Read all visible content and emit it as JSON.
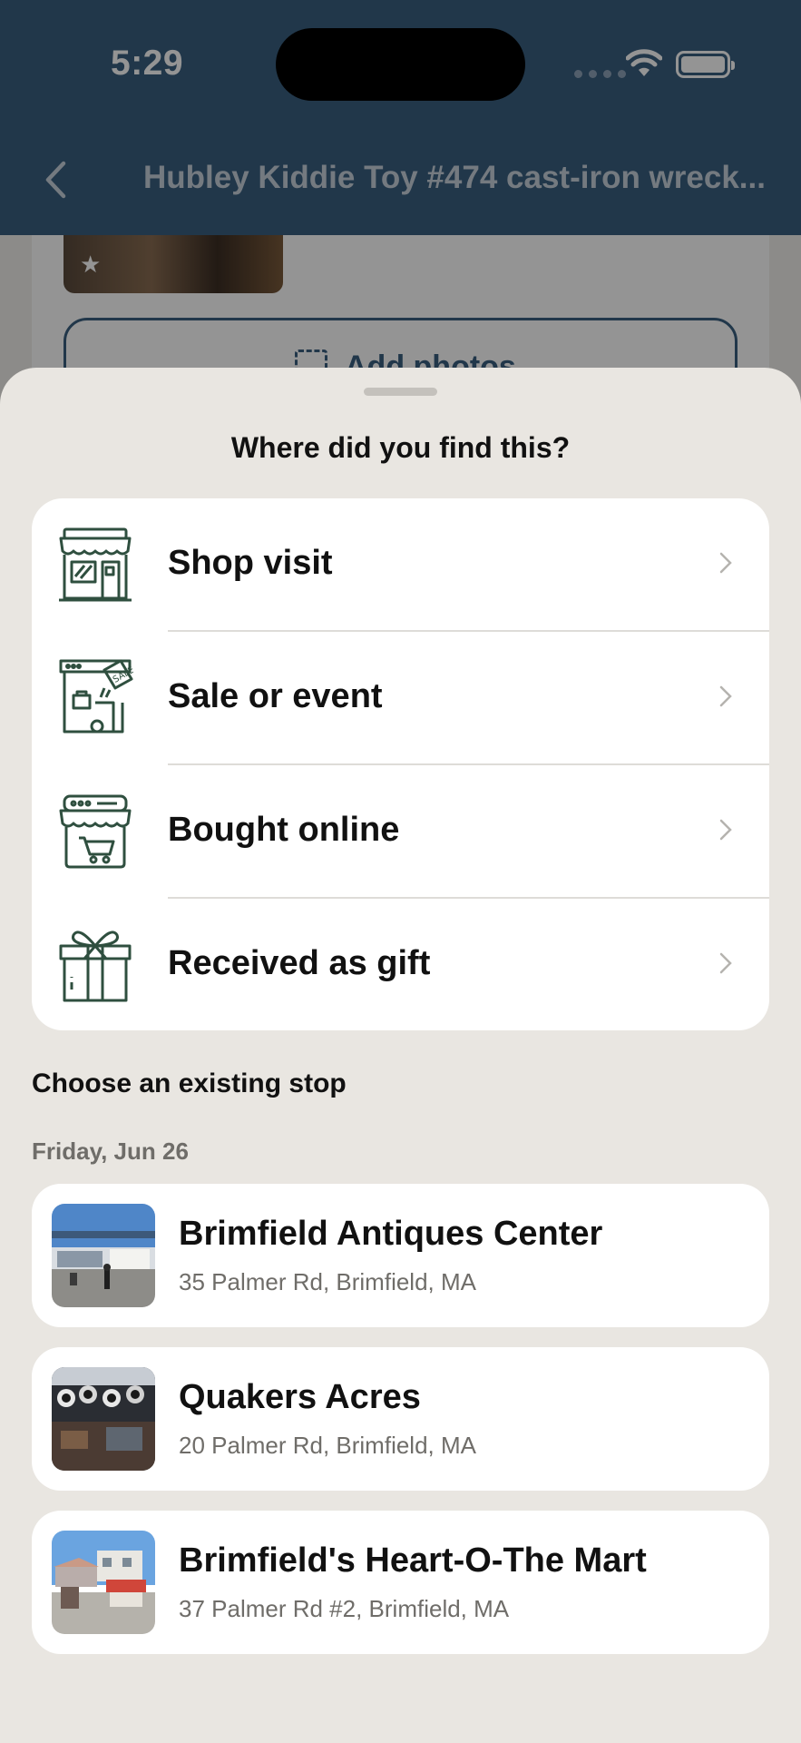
{
  "status_bar": {
    "time": "5:29"
  },
  "nav": {
    "title": "Hubley Kiddie Toy #474 cast-iron wreck..."
  },
  "background": {
    "add_photos_label": "Add photos"
  },
  "sheet": {
    "title": "Where did you find this?",
    "options": [
      {
        "label": "Shop visit",
        "icon": "shop-icon"
      },
      {
        "label": "Sale or event",
        "icon": "sale-tag-icon"
      },
      {
        "label": "Bought online",
        "icon": "online-store-cart-icon"
      },
      {
        "label": "Received as gift",
        "icon": "gift-box-icon"
      }
    ],
    "existing_stops_title": "Choose an existing stop",
    "date_group": "Friday, Jun 26",
    "stops": [
      {
        "name": "Brimfield Antiques Center",
        "address": "35 Palmer Rd, Brimfield, MA"
      },
      {
        "name": "Quakers Acres",
        "address": "20 Palmer Rd, Brimfield, MA"
      },
      {
        "name": "Brimfield's Heart-O-The Mart",
        "address": "37 Palmer Rd #2, Brimfield, MA"
      }
    ]
  },
  "colors": {
    "header": "#3a5f80",
    "sheet_bg": "#e9e6e1",
    "icon_green": "#2f4f3f",
    "secondary_text": "#6f6d69"
  }
}
